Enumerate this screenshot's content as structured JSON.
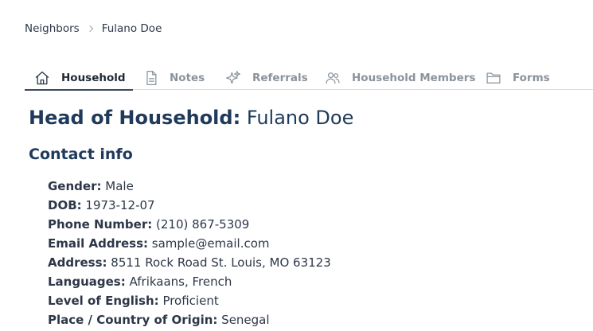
{
  "breadcrumb": {
    "parent": "Neighbors",
    "current": "Fulano Doe"
  },
  "tabs": [
    {
      "label": "Household",
      "icon": "home-icon",
      "active": true
    },
    {
      "label": "Notes",
      "icon": "document-icon",
      "active": false
    },
    {
      "label": "Referrals",
      "icon": "sparkles-icon",
      "active": false
    },
    {
      "label": "Household Members",
      "icon": "users-icon",
      "active": false
    },
    {
      "label": "Forms",
      "icon": "folder-icon",
      "active": false
    }
  ],
  "head_of_household": {
    "label": "Head of Household:",
    "name": "Fulano Doe"
  },
  "contact_info": {
    "title": "Contact info",
    "fields": [
      {
        "label": "Gender:",
        "value": "Male"
      },
      {
        "label": "DOB:",
        "value": "1973-12-07"
      },
      {
        "label": "Phone Number:",
        "value": "(210) 867-5309"
      },
      {
        "label": "Email Address:",
        "value": "sample@email.com"
      },
      {
        "label": "Address:",
        "value": "8511 Rock Road St. Louis, MO 63123"
      },
      {
        "label": "Languages:",
        "value": "Afrikaans, French"
      },
      {
        "label": "Level of English:",
        "value": "Proficient"
      },
      {
        "label": "Place / Country of Origin:",
        "value": "Senegal"
      }
    ]
  }
}
